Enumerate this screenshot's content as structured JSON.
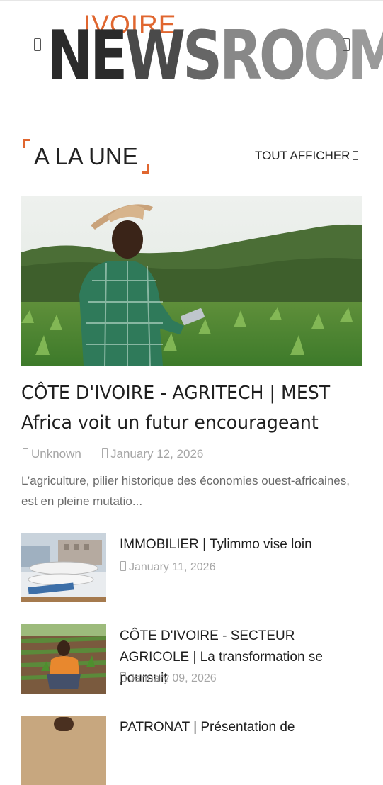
{
  "header": {
    "logo_top": "IVOIRE",
    "logo_main": [
      "NE",
      "W",
      "S",
      "RO",
      "OM"
    ],
    "left_icon": "menu-icon",
    "right_icon": "search-icon"
  },
  "section": {
    "title": "A LA UNE",
    "see_all": "TOUT AFFICHER"
  },
  "featured": {
    "title": "CÔTE D'IVOIRE - AGRITECH | MEST Africa voit un futur encourageant",
    "author": "Unknown",
    "date": "January 12, 2026",
    "excerpt": "L’agriculture, pilier historique des économies ouest-africaines, est en pleine mutatio..."
  },
  "articles": [
    {
      "title": "IMMOBILIER | Tylimmo vise loin",
      "date": "January 11, 2026"
    },
    {
      "title": "CÔTE D'IVOIRE - SECTEUR AGRICOLE | La transformation se poursuit",
      "date": "January 09, 2026"
    },
    {
      "title": "PATRONAT | Présentation de"
    }
  ],
  "colors": {
    "accent": "#e0662f",
    "text": "#222222",
    "muted": "#a5a5a5"
  }
}
